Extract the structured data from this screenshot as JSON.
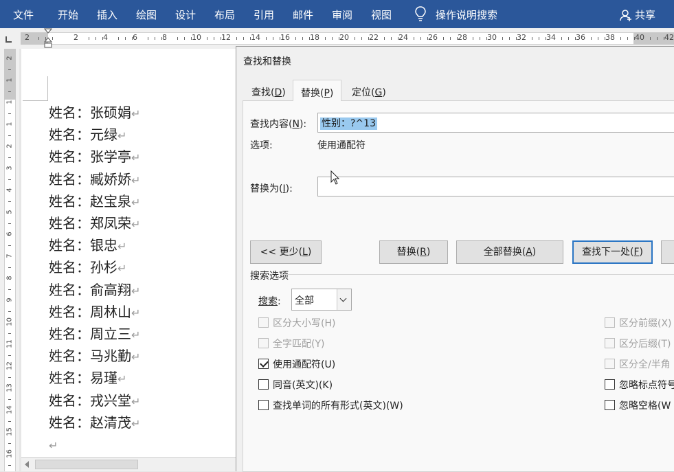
{
  "ribbon": {
    "tabs": [
      "文件",
      "开始",
      "插入",
      "绘图",
      "设计",
      "布局",
      "引用",
      "邮件",
      "审阅",
      "视图"
    ],
    "tell_me": "操作说明搜索",
    "share": "共享",
    "bg_color": "#2b579a"
  },
  "ruler": {
    "h_numbers": [
      "2",
      "2",
      "4",
      "6",
      "8",
      "10",
      "12",
      "14",
      "16",
      "18",
      "20",
      "22",
      "24",
      "26",
      "28",
      "30",
      "32",
      "34",
      "36",
      "38",
      "40",
      "42"
    ],
    "v_numbers": [
      "2",
      "1",
      "1",
      "1",
      "2",
      "3",
      "4",
      "5",
      "6",
      "7",
      "8",
      "9",
      "10",
      "11",
      "12",
      "13",
      "14",
      "15",
      "16"
    ]
  },
  "document": {
    "lines": [
      "姓名：张硕娟",
      "姓名：元绿",
      "姓名：张学亭",
      "姓名：臧娇娇",
      "姓名：赵宝泉",
      "姓名：郑凤荣",
      "姓名：银忠",
      "姓名：孙杉",
      "姓名：俞高翔",
      "姓名：周林山",
      "姓名：周立三",
      "姓名：马兆勤",
      "姓名：易瑾",
      "姓名：戎兴堂",
      "姓名：赵清茂"
    ],
    "para_mark": "↵"
  },
  "dialog": {
    "title": "查找和替换",
    "tabs": [
      {
        "label": "查找",
        "key": "D"
      },
      {
        "label": "替换",
        "key": "P"
      },
      {
        "label": "定位",
        "key": "G"
      }
    ],
    "find_label": "查找内容",
    "find_key": "N",
    "find_value": "性别：?^13",
    "options_label": "选项:",
    "options_value": "使用通配符",
    "replace_label": "替换为",
    "replace_key": "I",
    "replace_value": "",
    "buttons": {
      "less": {
        "label": "<< 更少",
        "key": "L"
      },
      "replace": {
        "label": "替换",
        "key": "R"
      },
      "replace_all": {
        "label": "全部替换",
        "key": "A"
      },
      "find_next": {
        "label": "查找下一处",
        "key": "F"
      }
    },
    "search_options_title": "搜索选项",
    "search_label": "搜索",
    "search_value": "全部",
    "left_options": [
      {
        "label": "区分大小写(H)",
        "checked": false,
        "disabled": true
      },
      {
        "label": "全字匹配(Y)",
        "checked": false,
        "disabled": true
      },
      {
        "label": "使用通配符(U)",
        "checked": true,
        "disabled": false
      },
      {
        "label": "同音(英文)(K)",
        "checked": false,
        "disabled": false
      },
      {
        "label": "查找单词的所有形式(英文)(W)",
        "checked": false,
        "disabled": false
      }
    ],
    "right_options": [
      {
        "label": "区分前缀(X)",
        "checked": false,
        "disabled": true
      },
      {
        "label": "区分后缀(T)",
        "checked": false,
        "disabled": true
      },
      {
        "label": "区分全/半角",
        "checked": false,
        "disabled": true
      },
      {
        "label": "忽略标点符号",
        "checked": false,
        "disabled": false
      },
      {
        "label": "忽略空格(W",
        "checked": false,
        "disabled": false
      }
    ]
  }
}
